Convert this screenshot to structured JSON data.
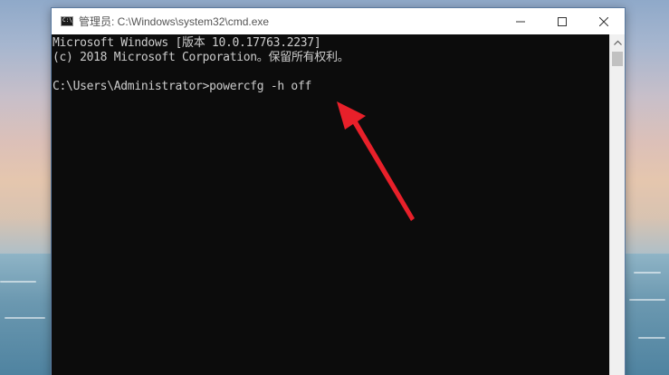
{
  "window": {
    "title": "管理员: C:\\Windows\\system32\\cmd.exe",
    "controls": {
      "minimize": "minimize-icon",
      "maximize": "maximize-icon",
      "close": "close-icon"
    }
  },
  "console": {
    "lines": [
      "Microsoft Windows [版本 10.0.17763.2237]",
      "(c) 2018 Microsoft Corporation。保留所有权利。",
      "",
      "C:\\Users\\Administrator>powercfg -h off"
    ]
  },
  "annotation": {
    "arrow_color": "#e8202a"
  },
  "colors": {
    "console_bg": "#0c0c0c",
    "console_fg": "#cccccc",
    "titlebar_bg": "#ffffff"
  }
}
